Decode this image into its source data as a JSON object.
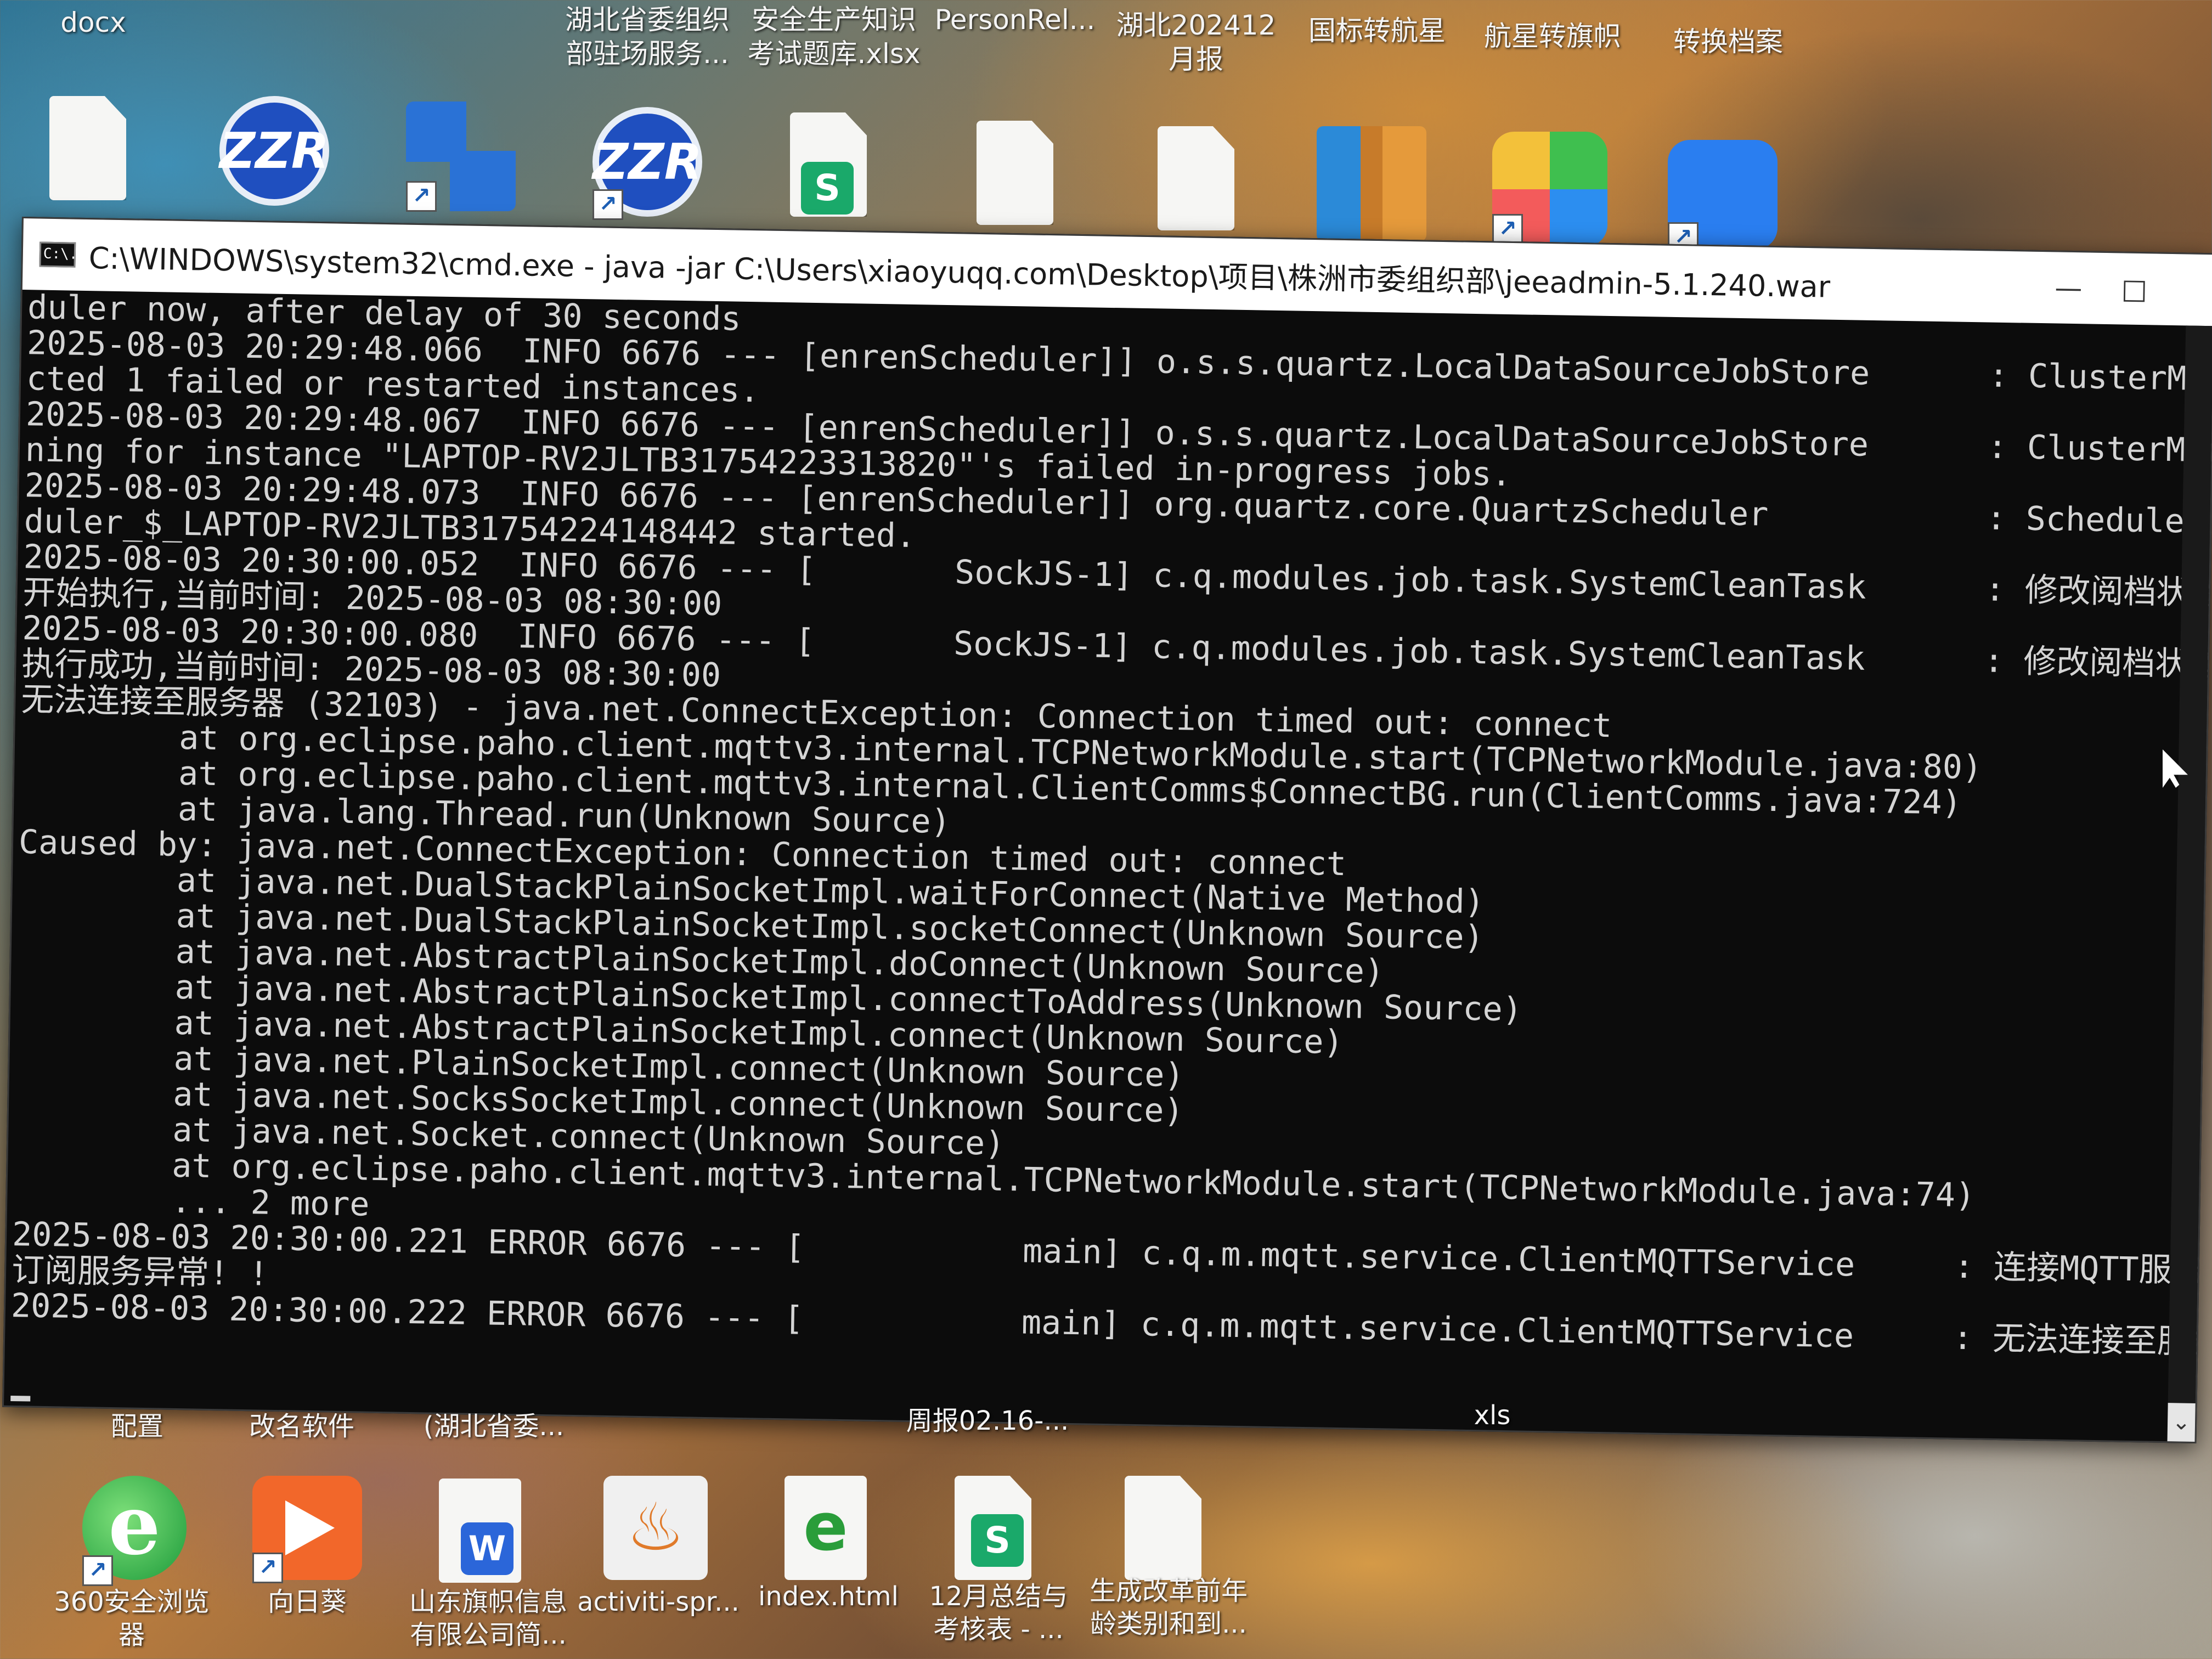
{
  "desktop_top": {
    "labels": [
      {
        "text": "docx"
      },
      {
        "text": "湖北省委组织\n部驻场服务..."
      },
      {
        "text": "安全生产知识\n考试题库.xlsx"
      },
      {
        "text": "PersonRel..."
      },
      {
        "text": "湖北202412\n月报"
      },
      {
        "text": "国标转航星"
      },
      {
        "text": "航星转旗帜"
      },
      {
        "text": "转换档案"
      }
    ],
    "icon_letters": {
      "zzr": "ZZR",
      "sheet": "S"
    }
  },
  "window": {
    "title": "C:\\WINDOWS\\system32\\cmd.exe - java  -jar C:\\Users\\xiaoyuqq.com\\Desktop\\项目\\株洲市委组织部\\jeeadmin-5.1.240.war",
    "icon_text": "C:\\.",
    "minimize": "—",
    "maximize": "□",
    "scroll_down": "⌄"
  },
  "console_lines": [
    "duler now, after delay of 30 seconds",
    "2025-08-03 20:29:48.066  INFO 6676 --- [enrenScheduler]] o.s.s.quartz.LocalDataSourceJobStore      : ClusterManager: de",
    "cted 1 failed or restarted instances.",
    "2025-08-03 20:29:48.067  INFO 6676 --- [enrenScheduler]] o.s.s.quartz.LocalDataSourceJobStore      : ClusterManager: Sc",
    "ning for instance \"LAPTOP-RV2JLTB31754223313820\"'s failed in-progress jobs.",
    "2025-08-03 20:29:48.073  INFO 6676 --- [enrenScheduler]] org.quartz.core.QuartzScheduler           : Scheduler RenrenSc",
    "duler_$_LAPTOP-RV2JLTB31754224148442 started.",
    "2025-08-03 20:30:00.052  INFO 6676 --- [       SockJS-1] c.q.modules.job.task.SystemCleanTask      : 修改阅档状态定时任",
    "开始执行,当前时间: 2025-08-03 08:30:00",
    "2025-08-03 20:30:00.080  INFO 6676 --- [       SockJS-1] c.q.modules.job.task.SystemCleanTask      : 修改阅档状态定时任",
    "执行成功,当前时间: 2025-08-03 08:30:00",
    "无法连接至服务器 (32103) - java.net.ConnectException: Connection timed out: connect",
    "        at org.eclipse.paho.client.mqttv3.internal.TCPNetworkModule.start(TCPNetworkModule.java:80)",
    "        at org.eclipse.paho.client.mqttv3.internal.ClientComms$ConnectBG.run(ClientComms.java:724)",
    "        at java.lang.Thread.run(Unknown Source)",
    "Caused by: java.net.ConnectException: Connection timed out: connect",
    "        at java.net.DualStackPlainSocketImpl.waitForConnect(Native Method)",
    "        at java.net.DualStackPlainSocketImpl.socketConnect(Unknown Source)",
    "        at java.net.AbstractPlainSocketImpl.doConnect(Unknown Source)",
    "        at java.net.AbstractPlainSocketImpl.connectToAddress(Unknown Source)",
    "        at java.net.AbstractPlainSocketImpl.connect(Unknown Source)",
    "        at java.net.PlainSocketImpl.connect(Unknown Source)",
    "        at java.net.SocksSocketImpl.connect(Unknown Source)",
    "        at java.net.Socket.connect(Unknown Source)",
    "        at org.eclipse.paho.client.mqttv3.internal.TCPNetworkModule.start(TCPNetworkModule.java:74)",
    "        ... 2 more",
    "2025-08-03 20:30:00.221 ERROR 6676 --- [           main] c.q.m.mqtt.service.ClientMQTTService     : 连接MQTT服务器失败,",
    "订阅服务异常! !",
    "2025-08-03 20:30:00.222 ERROR 6676 --- [           main] c.q.m.mqtt.service.ClientMQTTService     : 无法连接至服务器"
  ],
  "desktop_bottom": {
    "row_labels": [
      {
        "text": "配置"
      },
      {
        "text": "改名软件"
      },
      {
        "text": "(湖北省委..."
      },
      {
        "text": "周报02.16-..."
      },
      {
        "text": "xls"
      }
    ],
    "icons": [
      {
        "text": "360安全浏览\n器"
      },
      {
        "text": "向日葵"
      },
      {
        "text": "山东旗帜信息\n有限公司简..."
      },
      {
        "text": "activiti-spr..."
      },
      {
        "text": "index.html"
      },
      {
        "text": "12月总结与\n考核表 - ..."
      },
      {
        "text": "生成改革前年\n龄类别和到..."
      }
    ],
    "icon_glyphs": {
      "ie": "e",
      "word": "W",
      "java": "♨",
      "html": "e",
      "sheet": "S"
    }
  }
}
